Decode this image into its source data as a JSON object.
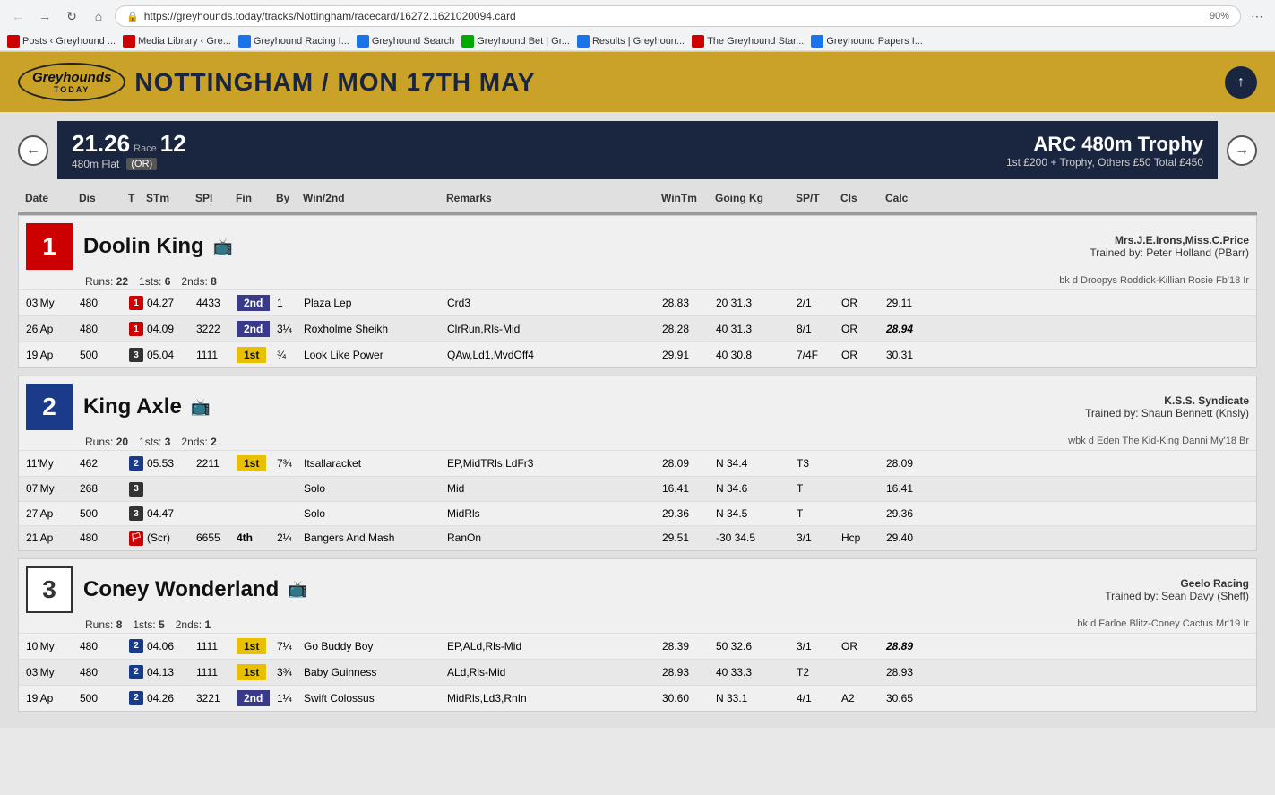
{
  "browser": {
    "back_disabled": false,
    "forward_disabled": false,
    "url": "https://greyhounds.today/tracks/Nottingham/racecard/16272.1621020094.card",
    "zoom": "90%",
    "bookmarks": [
      {
        "label": "Posts ‹ Greyhound ...",
        "color": "red"
      },
      {
        "label": "Media Library ‹ Gre...",
        "color": "red"
      },
      {
        "label": "Greyhound Racing I...",
        "color": "blue"
      },
      {
        "label": "Greyhound Search",
        "color": "blue"
      },
      {
        "label": "Greyhound Bet | Gr...",
        "color": "green"
      },
      {
        "label": "Results | Greyhoun...",
        "color": "blue"
      },
      {
        "label": "The Greyhound Star...",
        "color": "red"
      },
      {
        "label": "Greyhound Papers I...",
        "color": "blue"
      }
    ]
  },
  "header": {
    "logo_main": "Greyhounds",
    "logo_sub": "TODAY",
    "title": "Nottingham / Mon 17th May",
    "up_arrow": "↑"
  },
  "race": {
    "time": "21.26",
    "race_label": "Race",
    "race_num": "12",
    "dist": "480m Flat",
    "or_badge": "(OR)",
    "title": "ARC 480m Trophy",
    "prize": "1st £200 + Trophy, Others £50 Total £450"
  },
  "columns": {
    "date": "Date",
    "dis": "Dis",
    "t": "T",
    "stm": "STm",
    "spl": "SPl",
    "fin": "Fin",
    "by": "By",
    "win2nd": "Win/2nd",
    "remarks": "Remarks",
    "wintm": "WinTm",
    "going_kg": "Going Kg",
    "spt": "SP/T",
    "cls": "Cls",
    "calc": "Calc"
  },
  "dogs": [
    {
      "num": "1",
      "badge_class": "badge-red",
      "name": "Doolin King",
      "tv": true,
      "owner": "Mrs.J.E.Irons,Miss.C.Price",
      "trainer": "Trained by: Peter Holland (PBarr)",
      "runs": "22",
      "sts1": "6",
      "nds2": "8",
      "breed": "bk d Droopys Roddick-Killian Rosie Fb'18 Ir",
      "races": [
        {
          "date": "03'My",
          "dis": "480",
          "trap": "1",
          "trap_class": "trap-1",
          "stm": "04.27",
          "spl": "4433",
          "fin": "2nd",
          "fin_class": "fin-2nd",
          "by": "1",
          "win2nd": "Plaza Lep",
          "remarks": "Crd3",
          "wintm": "28.83",
          "going": "20",
          "kg": "31.3",
          "spt": "2/1",
          "cls": "OR",
          "calc": "29.11",
          "calc_italic": false
        },
        {
          "date": "26'Ap",
          "dis": "480",
          "trap": "1",
          "trap_class": "trap-1",
          "stm": "04.09",
          "spl": "3222",
          "fin": "2nd",
          "fin_class": "fin-2nd",
          "by": "3¼",
          "win2nd": "Roxholme Sheikh",
          "remarks": "ClrRun,Rls-Mid",
          "wintm": "28.28",
          "going": "40",
          "kg": "31.3",
          "spt": "8/1",
          "cls": "OR",
          "calc": "28.94",
          "calc_italic": true
        },
        {
          "date": "19'Ap",
          "dis": "500",
          "trap": "3",
          "trap_class": "trap-3",
          "stm": "05.04",
          "spl": "1111",
          "fin": "1st",
          "fin_class": "fin-1st",
          "by": "¾",
          "win2nd": "Look Like Power",
          "remarks": "QAw,Ld1,MvdOff4",
          "wintm": "29.91",
          "going": "40",
          "kg": "30.8",
          "spt": "7/4F",
          "cls": "OR",
          "calc": "30.31",
          "calc_italic": false
        }
      ]
    },
    {
      "num": "2",
      "badge_class": "badge-blue",
      "name": "King Axle",
      "tv": true,
      "owner": "K.S.S. Syndicate",
      "trainer": "Trained by: Shaun Bennett (Knsly)",
      "runs": "20",
      "sts1": "3",
      "nds2": "2",
      "breed": "wbk d Eden The Kid-King Danni My'18 Br",
      "races": [
        {
          "date": "11'My",
          "dis": "462",
          "trap": "2",
          "trap_class": "trap-2",
          "stm": "05.53",
          "spl": "2211",
          "fin": "1st",
          "fin_class": "fin-1st",
          "by": "7¾",
          "win2nd": "Itsallaracket",
          "remarks": "EP,MidTRls,LdFr3",
          "wintm": "28.09",
          "going": "N",
          "kg": "34.4",
          "spt": "T3",
          "cls": "",
          "calc": "28.09",
          "calc_italic": false
        },
        {
          "date": "07'My",
          "dis": "268",
          "trap": "3",
          "trap_class": "trap-3",
          "stm": "",
          "spl": "",
          "fin": "",
          "fin_class": "",
          "by": "",
          "win2nd": "Solo",
          "remarks": "Mid",
          "wintm": "16.41",
          "going": "N",
          "kg": "34.6",
          "spt": "T",
          "cls": "",
          "calc": "16.41",
          "calc_italic": false
        },
        {
          "date": "27'Ap",
          "dis": "500",
          "trap": "3",
          "trap_class": "trap-3",
          "stm": "04.47",
          "spl": "",
          "fin": "",
          "fin_class": "",
          "by": "",
          "win2nd": "Solo",
          "remarks": "MidRls",
          "wintm": "29.36",
          "going": "N",
          "kg": "34.5",
          "spt": "T",
          "cls": "",
          "calc": "29.36",
          "calc_italic": false
        },
        {
          "date": "21'Ap",
          "dis": "480",
          "trap": "flag",
          "trap_class": "trap-flag",
          "stm": "(Scr)",
          "spl": "6655",
          "fin": "4th",
          "fin_class": "fin-4th",
          "by": "2¼",
          "win2nd": "Bangers And Mash",
          "remarks": "RanOn",
          "wintm": "29.51",
          "going": "-30",
          "kg": "34.5",
          "spt": "3/1",
          "cls": "Hcp",
          "calc": "29.40",
          "calc_italic": false
        }
      ]
    },
    {
      "num": "3",
      "badge_class": "badge-white",
      "name": "Coney Wonderland",
      "tv": true,
      "owner": "Geelo Racing",
      "trainer": "Trained by: Sean Davy (Sheff)",
      "runs": "8",
      "sts1": "5",
      "nds2": "1",
      "breed": "bk d Farloe Blitz-Coney Cactus Mr'19 Ir",
      "races": [
        {
          "date": "10'My",
          "dis": "480",
          "trap": "2",
          "trap_class": "trap-2",
          "stm": "04.06",
          "spl": "1111",
          "fin": "1st",
          "fin_class": "fin-1st",
          "by": "7¼",
          "win2nd": "Go Buddy Boy",
          "remarks": "EP,ALd,Rls-Mid",
          "wintm": "28.39",
          "going": "50",
          "kg": "32.6",
          "spt": "3/1",
          "cls": "OR",
          "calc": "28.89",
          "calc_italic": true
        },
        {
          "date": "03'My",
          "dis": "480",
          "trap": "2",
          "trap_class": "trap-2",
          "stm": "04.13",
          "spl": "1111",
          "fin": "1st",
          "fin_class": "fin-1st",
          "by": "3¾",
          "win2nd": "Baby Guinness",
          "remarks": "ALd,Rls-Mid",
          "wintm": "28.93",
          "going": "40",
          "kg": "33.3",
          "spt": "T2",
          "cls": "",
          "calc": "28.93",
          "calc_italic": false
        },
        {
          "date": "19'Ap",
          "dis": "500",
          "trap": "2",
          "trap_class": "trap-2",
          "stm": "04.26",
          "spl": "3221",
          "fin": "2nd",
          "fin_class": "fin-2nd",
          "by": "1¼",
          "win2nd": "Swift Colossus",
          "remarks": "MidRls,Ld3,RnIn",
          "wintm": "30.60",
          "going": "N",
          "kg": "33.1",
          "spt": "4/1",
          "cls": "A2",
          "calc": "30.65",
          "calc_italic": false
        }
      ]
    }
  ]
}
